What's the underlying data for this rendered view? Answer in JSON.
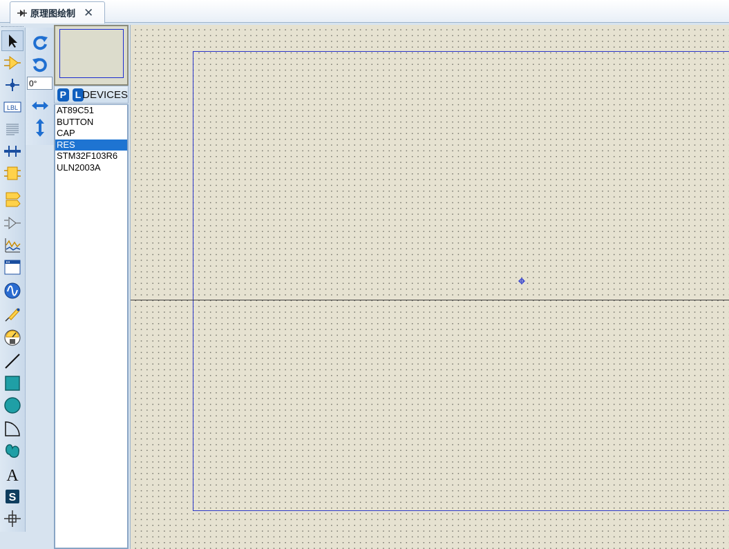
{
  "tab": {
    "label": "原理图绘制",
    "close": "✕"
  },
  "orientation": {
    "angle": "0°"
  },
  "devices_panel": {
    "badge_p": "P",
    "badge_l": "L",
    "title": "DEVICES",
    "items": [
      "AT89C51",
      "BUTTON",
      "CAP",
      "RES",
      "STM32F103R6",
      "ULN2003A"
    ],
    "selected": "RES"
  },
  "tools": [
    "selection-mode-icon",
    "component-mode-icon",
    "junction-dot-icon",
    "wire-label-icon",
    "text-script-icon",
    "bus-icon",
    "subcircuit-icon",
    "terminal-icon",
    "device-pin-icon",
    "graph-icon",
    "tape-recorder-icon",
    "generator-icon",
    "voltage-probe-icon",
    "virtual-instrument-icon",
    "line-icon",
    "box-icon",
    "circle-icon",
    "arc-icon",
    "path-icon",
    "text-icon",
    "symbol-icon",
    "marker-icon"
  ],
  "colors": {
    "accent": "#1e74d2",
    "sheet_border": "#2a35c9",
    "canvas_bg": "#e6e2d1"
  }
}
